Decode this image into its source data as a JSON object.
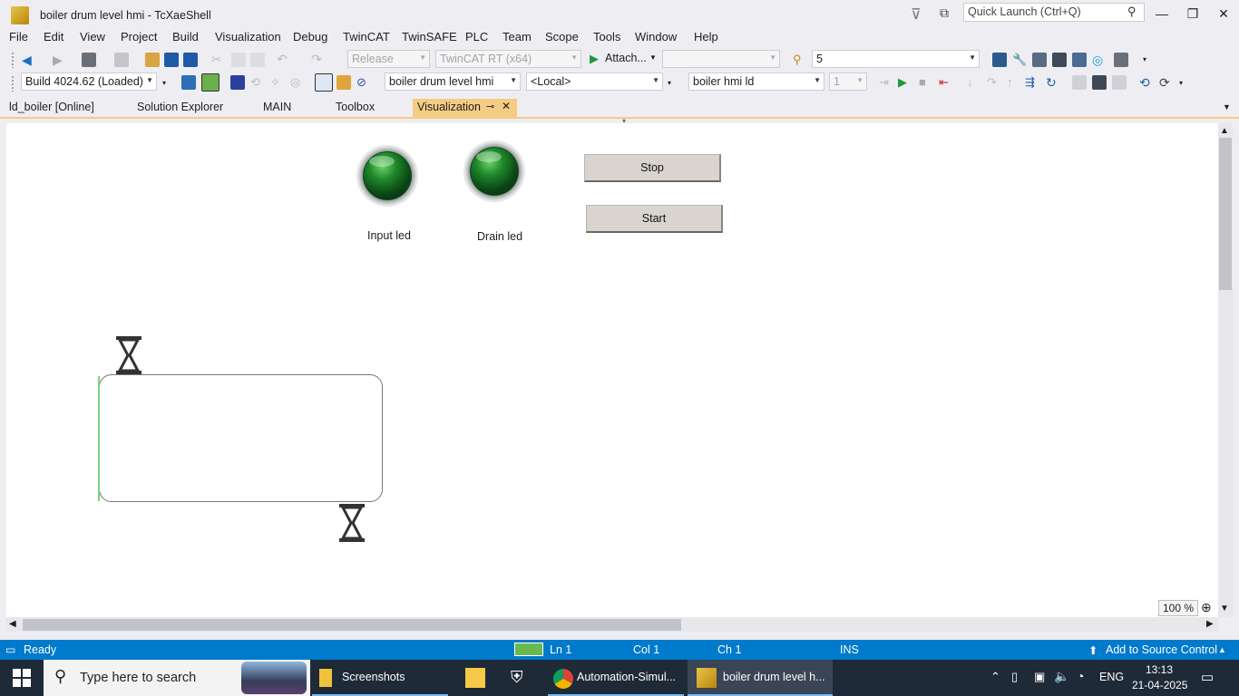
{
  "window": {
    "title": "boiler drum level hmi - TcXaeShell",
    "quick_launch_placeholder": "Quick Launch (Ctrl+Q)"
  },
  "menu": [
    "File",
    "Edit",
    "View",
    "Project",
    "Build",
    "Visualization",
    "Debug",
    "TwinCAT",
    "TwinSAFE",
    "PLC",
    "Team",
    "Scope",
    "Tools",
    "Window",
    "Help"
  ],
  "toolbar1": {
    "configuration": "Release",
    "platform": "TwinCAT RT (x64)",
    "attach_label": "Attach...",
    "search_value": "5"
  },
  "toolbar2": {
    "build": "Build 4024.62 (Loaded)",
    "project": "boiler drum level hmi",
    "target": "<Local>",
    "plc_project": "boiler hmi ld",
    "task_index": "1"
  },
  "tabs": [
    {
      "label": "ld_boiler [Online]"
    },
    {
      "label": "Solution Explorer"
    },
    {
      "label": "MAIN"
    },
    {
      "label": "Toolbox"
    },
    {
      "label": "Visualization",
      "active": true
    }
  ],
  "visualization": {
    "input_led_label": "Input led",
    "drain_led_label": "Drain led",
    "stop_label": "Stop",
    "start_label": "Start",
    "tank_level_percent": 0,
    "zoom": "100 %"
  },
  "status": {
    "state": "Ready",
    "line": "Ln 1",
    "col": "Col 1",
    "ch": "Ch 1",
    "mode": "INS",
    "source_control": "Add to Source Control"
  },
  "taskbar": {
    "search_placeholder": "Type here to search",
    "apps": [
      {
        "label": "Screenshots"
      },
      {
        "label": "Automation-Simul..."
      },
      {
        "label": "boiler drum level h..."
      }
    ],
    "language": "ENG",
    "time": "13:13",
    "date": "21-04-2025"
  },
  "colors": {
    "accent_tab": "#f5cc84",
    "status_bar": "#007acc",
    "taskbar": "#1f2a38"
  }
}
